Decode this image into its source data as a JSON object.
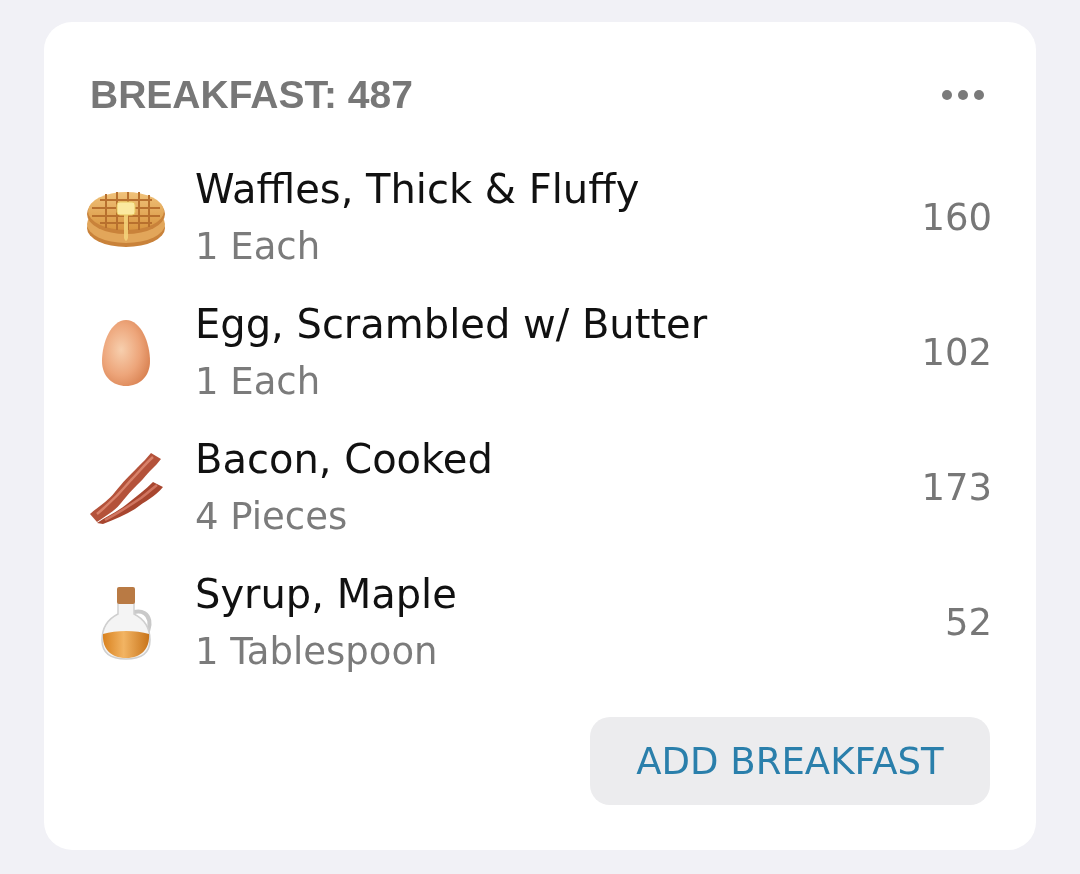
{
  "meal": {
    "title": "BREAKFAST: 487"
  },
  "foods": [
    {
      "name": "Waffles, Thick & Fluffy",
      "serving": "1 Each",
      "calories": "160"
    },
    {
      "name": "Egg, Scrambled w/ Butter",
      "serving": "1 Each",
      "calories": "102"
    },
    {
      "name": "Bacon, Cooked",
      "serving": "4 Pieces",
      "calories": "173"
    },
    {
      "name": "Syrup, Maple",
      "serving": "1 Tablespoon",
      "calories": "52"
    }
  ],
  "add_button": {
    "label": "ADD BREAKFAST"
  }
}
